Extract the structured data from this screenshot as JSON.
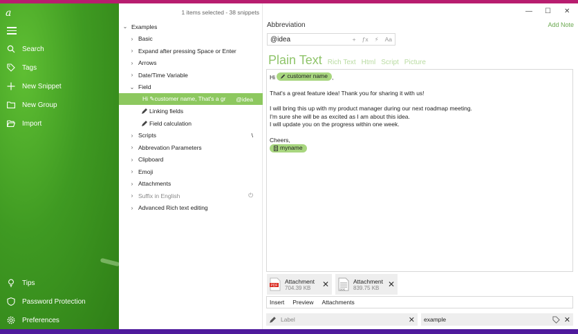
{
  "sidebar": {
    "logo": "a",
    "items": [
      {
        "label": "Search",
        "icon": "search-icon"
      },
      {
        "label": "Tags",
        "icon": "tag-icon"
      },
      {
        "label": "New Snippet",
        "icon": "plus-icon"
      },
      {
        "label": "New Group",
        "icon": "folder-plus-icon"
      },
      {
        "label": "Import",
        "icon": "folder-open-icon"
      }
    ],
    "bottom_items": [
      {
        "label": "Tips",
        "icon": "lightbulb-icon"
      },
      {
        "label": "Password Protection",
        "icon": "shield-icon"
      },
      {
        "label": "Preferences",
        "icon": "gear-icon"
      }
    ]
  },
  "list": {
    "status": "1 items selected - 38 snippets",
    "rows": [
      {
        "label": "Examples",
        "chev": "v",
        "indent": 0
      },
      {
        "label": "Basic",
        "chev": ">",
        "indent": 1
      },
      {
        "label": "Expand after pressing Space or Enter",
        "chev": ">",
        "indent": 1
      },
      {
        "label": "Arrows",
        "chev": ">",
        "indent": 1
      },
      {
        "label": "Date/Time Variable",
        "chev": ">",
        "indent": 1
      },
      {
        "label": "Field",
        "chev": "v",
        "indent": 1
      },
      {
        "label": "Hi ✎customer name,  That's a gr",
        "right": "@idea",
        "indent": 2,
        "selected": true
      },
      {
        "label": "Linking fields",
        "indent": 2,
        "pen": true
      },
      {
        "label": "Field calculation",
        "indent": 2,
        "pen": true
      },
      {
        "label": "Scripts",
        "chev": ">",
        "indent": 1,
        "right": "\\"
      },
      {
        "label": "Abbrevation Parameters",
        "chev": ">",
        "indent": 1
      },
      {
        "label": "Clipboard",
        "chev": ">",
        "indent": 1
      },
      {
        "label": "Emoji",
        "chev": ">",
        "indent": 1
      },
      {
        "label": "Attachments",
        "chev": ">",
        "indent": 1
      },
      {
        "label": "Suffix in English",
        "chev": ">",
        "indent": 1,
        "muted": true,
        "right": "⏻"
      },
      {
        "label": "Advanced Rich text editing",
        "chev": ">",
        "indent": 1
      }
    ]
  },
  "window": {
    "minimize": "—",
    "maximize": "☐",
    "close": "✕"
  },
  "editor": {
    "abbreviation_label": "Abbreviation",
    "add_note": "Add Note",
    "abbreviation_value": "@idea",
    "tools": [
      "+",
      "ƒx",
      "⚡",
      "Aa"
    ],
    "tabs": {
      "main": "Plain Text",
      "others": [
        "Rich Text",
        "Html",
        "Script",
        "Picture"
      ]
    },
    "content": {
      "hi": "Hi",
      "chip1": "customer name",
      "comma": ",",
      "line2": "That's a great feature idea! Thank you for sharing it with us!",
      "line3": "I will bring this up with my product manager during our next roadmap meeting.",
      "line4": "I'm sure she will be as excited as I am about this idea.",
      "line5": "I will update you on the progress within one week.",
      "cheers": "Cheers,",
      "chip2": "myname"
    },
    "attachments": [
      {
        "name": "Attachment",
        "size": "704.39 KB",
        "icon": "pdf-file-icon",
        "type": "PDF"
      },
      {
        "name": "Attachment",
        "size": "839.75 KB",
        "icon": "document-file-icon",
        "type": "DOC"
      }
    ],
    "actions": [
      "Insert",
      "Preview",
      "Attachments"
    ],
    "label_placeholder": "Label",
    "tag_value": "example"
  }
}
